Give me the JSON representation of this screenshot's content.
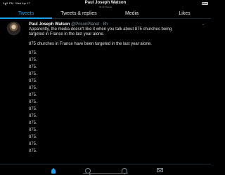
{
  "status": {
    "time": "9:41 PM",
    "date": "Wed Apr 17"
  },
  "header": {
    "name": "Paul Joseph Watson",
    "subtitle": "54.1K Tweets"
  },
  "tabs": [
    {
      "label": "Tweets"
    },
    {
      "label": "Tweets & replies"
    },
    {
      "label": "Media"
    },
    {
      "label": "Likes"
    }
  ],
  "tweet": {
    "author": "Paul Joseph Watson",
    "handle": "@PrisonPlanet",
    "time": "· 8h",
    "lines": [
      "Apparently, the media doesn't like it when you talk about 875 churches being",
      "targeted in France in the last year alone.",
      "875 churches in France have been targeted in the last year alone.",
      "875.",
      "875.",
      "875.",
      "875.",
      "875.",
      "875.",
      "875.",
      "875.",
      "875.",
      "875.",
      "875.",
      "875.",
      "875.",
      "875.",
      "875."
    ]
  },
  "icons": {
    "back": "back-arrow-icon",
    "more": "more-icon",
    "home": "home-icon",
    "search": "search-icon",
    "notifications": "bell-icon",
    "messages": "mail-icon"
  },
  "colors": {
    "accent": "#1da1f2",
    "background": "#000000",
    "text": "#e6e6e6",
    "muted": "#8d9aa6"
  }
}
